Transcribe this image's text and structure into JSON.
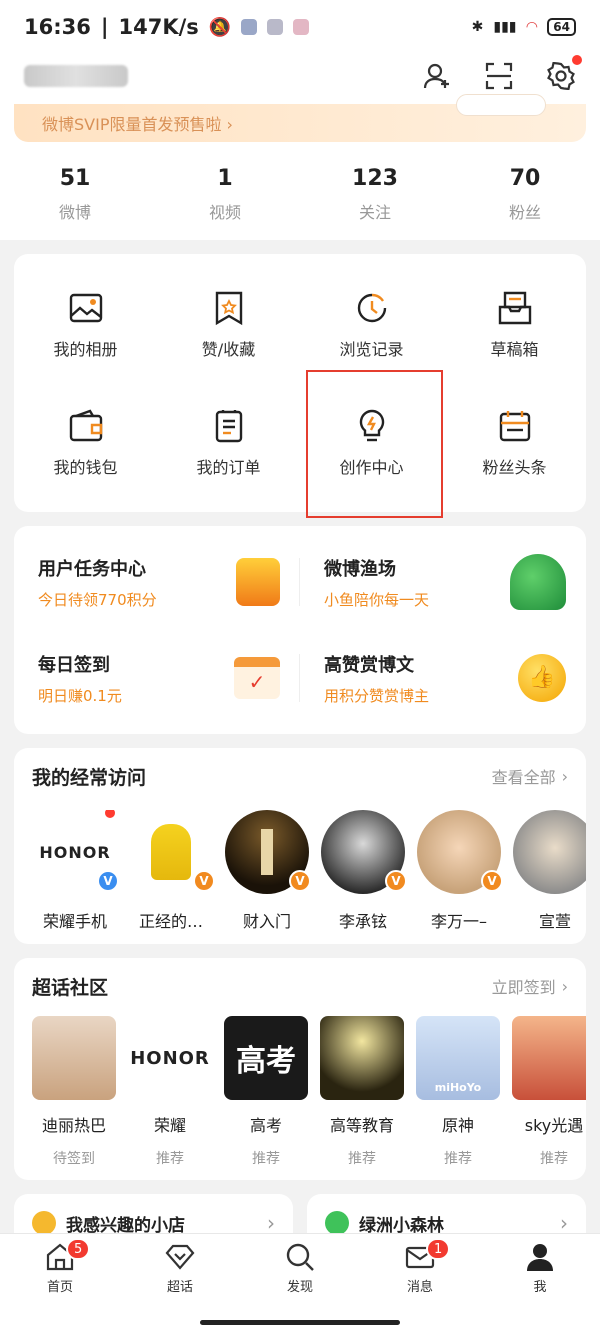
{
  "status": {
    "time": "16:36",
    "speed": "147K/s",
    "battery": "64"
  },
  "vip_banner": {
    "text": "微博SVIP限量首发预售啦 ›"
  },
  "stats": [
    {
      "num": "51",
      "label": "微博"
    },
    {
      "num": "1",
      "label": "视频"
    },
    {
      "num": "123",
      "label": "关注"
    },
    {
      "num": "70",
      "label": "粉丝"
    }
  ],
  "grid": [
    {
      "label": "我的相册",
      "icon": "photo-album-icon"
    },
    {
      "label": "赞/收藏",
      "icon": "favorite-icon"
    },
    {
      "label": "浏览记录",
      "icon": "history-icon"
    },
    {
      "label": "草稿箱",
      "icon": "drafts-icon"
    },
    {
      "label": "我的钱包",
      "icon": "wallet-icon"
    },
    {
      "label": "我的订单",
      "icon": "orders-icon"
    },
    {
      "label": "创作中心",
      "icon": "lightbulb-icon"
    },
    {
      "label": "粉丝头条",
      "icon": "fans-headline-icon"
    }
  ],
  "tasks": [
    {
      "title": "用户任务中心",
      "sub": "今日待领770积分"
    },
    {
      "title": "微博渔场",
      "sub": "小鱼陪你每一天"
    },
    {
      "title": "每日签到",
      "sub": "明日赚0.1元"
    },
    {
      "title": "高赞赏博文",
      "sub": "用积分赞赏博主"
    }
  ],
  "frequent": {
    "title": "我的经常访问",
    "more": "查看全部",
    "items": [
      {
        "name": "荣耀手机",
        "pic_text": "HONOR"
      },
      {
        "name": "正经的…",
        "pic_text": ""
      },
      {
        "name": "财入门",
        "pic_text": ""
      },
      {
        "name": "李承铉",
        "pic_text": ""
      },
      {
        "name": "李万一–",
        "pic_text": ""
      },
      {
        "name": "宣萱",
        "pic_text": ""
      }
    ]
  },
  "supertopic": {
    "title": "超话社区",
    "more": "立即签到",
    "items": [
      {
        "name": "迪丽热巴",
        "sub": "待签到",
        "pic_text": ""
      },
      {
        "name": "荣耀",
        "sub": "推荐",
        "pic_text": "HONOR"
      },
      {
        "name": "高考",
        "sub": "推荐",
        "pic_text": "高考"
      },
      {
        "name": "高等教育",
        "sub": "推荐",
        "pic_text": ""
      },
      {
        "name": "原神",
        "sub": "推荐",
        "pic_text": "miHoYo"
      },
      {
        "name": "sky光遇",
        "sub": "推荐",
        "pic_text": ""
      }
    ]
  },
  "shops": [
    {
      "label": "我感兴趣的小店"
    },
    {
      "label": "绿洲小森林"
    }
  ],
  "tabs": [
    {
      "label": "首页",
      "badge": "5"
    },
    {
      "label": "超话",
      "badge": ""
    },
    {
      "label": "发现",
      "badge": ""
    },
    {
      "label": "消息",
      "badge": "1"
    },
    {
      "label": "我",
      "badge": ""
    }
  ],
  "colors": {
    "accent": "#f08b20",
    "highlight_box": "#e53d2f",
    "badge": "#f23a30"
  }
}
